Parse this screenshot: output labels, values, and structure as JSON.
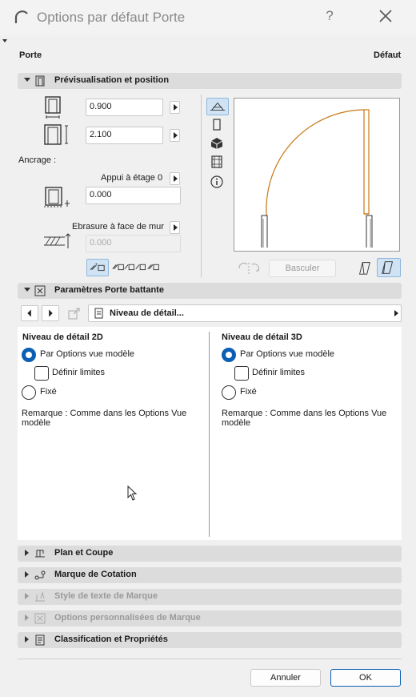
{
  "window": {
    "title": "Options par défaut Porte",
    "help": "?",
    "close": "✕"
  },
  "header": {
    "left": "Porte",
    "right": "Défaut"
  },
  "preview_section": {
    "title": "Prévisualisation et position",
    "width_value": "0.900",
    "height_value": "2.100",
    "anchor_label": "Ancrage :",
    "anchor_option": "Appui à étage 0",
    "anchor_value": "0.000",
    "reveal_option": "Ebrasure à face de mur",
    "reveal_value": "0.000",
    "flip_button": "Basculer"
  },
  "params_section": {
    "title": "Paramètres Porte battante",
    "dropdown_label": "Niveau de détail..."
  },
  "detail2d": {
    "title": "Niveau de détail 2D",
    "option_model": "Par Options vue modèle",
    "option_limits": "Définir limites",
    "option_fixed": "Fixé",
    "remark": "Remarque : Comme dans les Options Vue modèle"
  },
  "detail3d": {
    "title": "Niveau de détail 3D",
    "option_model": "Par Options vue modèle",
    "option_limits": "Définir limites",
    "option_fixed": "Fixé",
    "remark": "Remarque : Comme dans les Options Vue modèle"
  },
  "sections": {
    "plan": "Plan et Coupe",
    "dimension": "Marque de Cotation",
    "text_style": "Style de texte de Marque",
    "custom_marker": "Options personnalisées de Marque",
    "classification": "Classification et Propriétés"
  },
  "footer": {
    "cancel": "Annuler",
    "ok": "OK"
  },
  "colors": {
    "accent": "#0a5fb4",
    "door_outline": "#c87814"
  }
}
